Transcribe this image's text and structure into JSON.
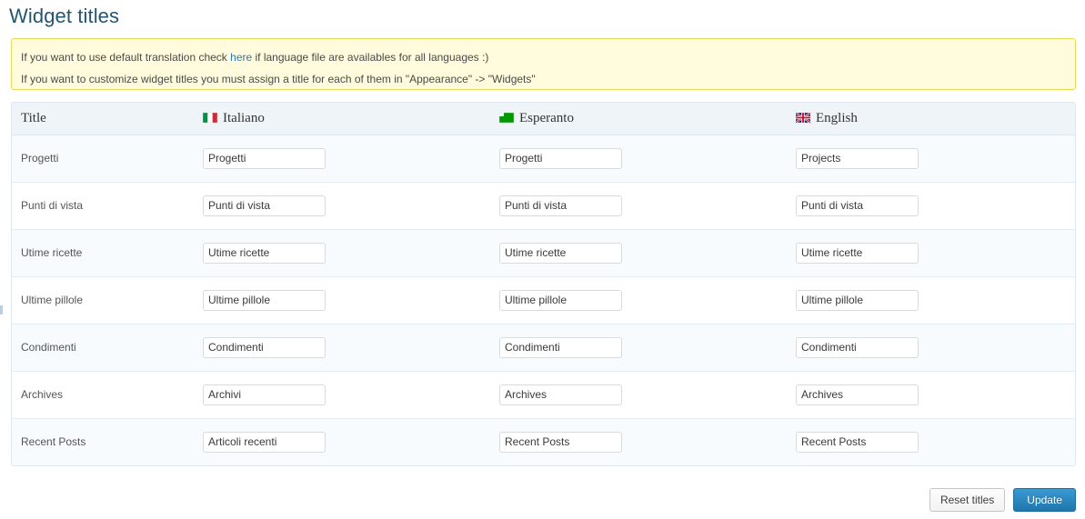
{
  "page": {
    "title": "Widget titles"
  },
  "notice": {
    "line1_before": "If you want to use default translation check ",
    "line1_link": "here",
    "line1_after": " if language file are availables for all languages :)",
    "line2": "If you want to customize widget titles you must assign a title for each of them in \"Appearance\" -> \"Widgets\"",
    "background_color": "#fffbdc",
    "border_color": "#e6db55",
    "link_color": "#2e7bb5"
  },
  "table": {
    "columns": [
      {
        "key": "title",
        "label": "Title",
        "flag": null
      },
      {
        "key": "italiano",
        "label": "Italiano",
        "flag": "flag-italy-icon"
      },
      {
        "key": "esperanto",
        "label": "Esperanto",
        "flag": "flag-esperanto-icon"
      },
      {
        "key": "english",
        "label": "English",
        "flag": "flag-uk-icon"
      }
    ],
    "rows": [
      {
        "title": "Progetti",
        "italiano": "Progetti",
        "esperanto": "Progetti",
        "english": "Projects"
      },
      {
        "title": "Punti di vista",
        "italiano": "Punti di vista",
        "esperanto": "Punti di vista",
        "english": "Punti di vista"
      },
      {
        "title": "Utime ricette",
        "italiano": "Utime ricette",
        "esperanto": "Utime ricette",
        "english": "Utime ricette"
      },
      {
        "title": "Ultime pillole",
        "italiano": "Ultime pillole",
        "esperanto": "Ultime pillole",
        "english": "Ultime pillole"
      },
      {
        "title": "Condimenti",
        "italiano": "Condimenti",
        "esperanto": "Condimenti",
        "english": "Condimenti"
      },
      {
        "title": "Archives",
        "italiano": "Archivi",
        "esperanto": "Archives",
        "english": "Archives"
      },
      {
        "title": "Recent Posts",
        "italiano": "Articoli recenti",
        "esperanto": "Recent Posts",
        "english": "Recent Posts"
      }
    ]
  },
  "actions": {
    "reset_label": "Reset titles",
    "update_label": "Update",
    "primary_color": "#2480b8"
  }
}
